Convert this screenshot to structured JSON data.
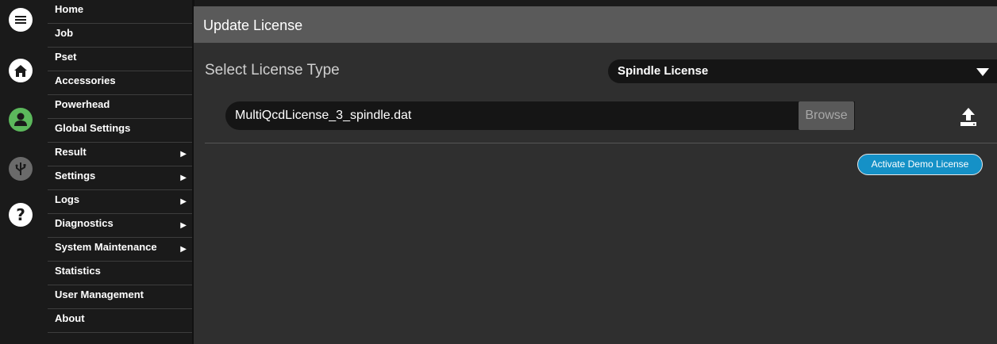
{
  "menu": {
    "items": [
      {
        "label": "Home",
        "has_submenu": false
      },
      {
        "label": "Job",
        "has_submenu": false
      },
      {
        "label": "Pset",
        "has_submenu": false
      },
      {
        "label": "Accessories",
        "has_submenu": false
      },
      {
        "label": "Powerhead",
        "has_submenu": false
      },
      {
        "label": "Global Settings",
        "has_submenu": false
      },
      {
        "label": "Result",
        "has_submenu": true
      },
      {
        "label": "Settings",
        "has_submenu": true
      },
      {
        "label": "Logs",
        "has_submenu": true
      },
      {
        "label": "Diagnostics",
        "has_submenu": true
      },
      {
        "label": "System Maintenance",
        "has_submenu": true
      },
      {
        "label": "Statistics",
        "has_submenu": false
      },
      {
        "label": "User Management",
        "has_submenu": false
      },
      {
        "label": "About",
        "has_submenu": false
      }
    ],
    "submenu_arrow": "▶"
  },
  "iconbar": {
    "icons": [
      "menu-icon",
      "home-icon",
      "user-icon",
      "usb-icon",
      "help-icon"
    ],
    "user_color": "#5cb85c"
  },
  "page": {
    "title": "Update License",
    "select_label": "Select License Type",
    "license_type": "Spindle License",
    "file_value": "MultiQcdLicense_3_spindle.dat",
    "browse_label": "Browse",
    "demo_button": "Activate Demo License"
  },
  "colors": {
    "accent": "#1591c7",
    "header_bg": "#5a5a5a",
    "panel_bg": "#2f2f2f"
  }
}
